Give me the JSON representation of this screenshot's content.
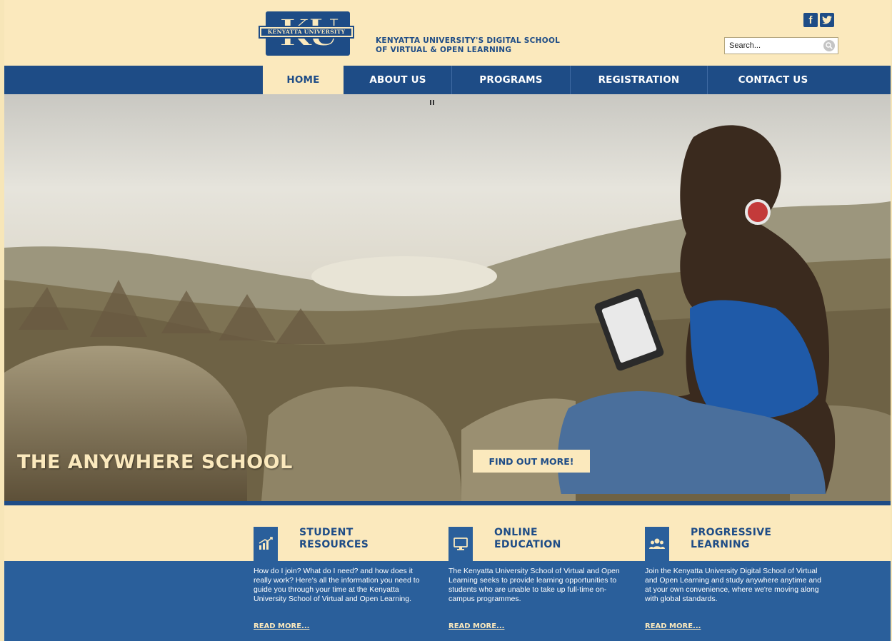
{
  "header": {
    "logo_initials": "KU",
    "logo_banner": "KENYATTA UNIVERSITY",
    "tagline_line1": "KENYATTA UNIVERSITY'S DIGITAL SCHOOL",
    "tagline_line2": "OF VIRTUAL & OPEN LEARNING",
    "social": {
      "facebook": "f",
      "twitter": "t"
    },
    "search_placeholder": "Search..."
  },
  "nav": {
    "items": [
      {
        "label": "HOME",
        "active": true
      },
      {
        "label": "ABOUT US",
        "active": false
      },
      {
        "label": "PROGRAMS",
        "active": false
      },
      {
        "label": "REGISTRATION",
        "active": false
      },
      {
        "label": "CONTACT US",
        "active": false
      }
    ]
  },
  "hero": {
    "title": "THE ANYWHERE SCHOOL",
    "button": "FIND OUT MORE!"
  },
  "features": [
    {
      "icon": "chart-up-icon",
      "title_line1": "STUDENT",
      "title_line2": "RESOURCES",
      "description": "How do I join? What do I need? and how does it really work? Here's all the information you need to guide you through your time at the Kenyatta University School of Virtual and Open Learning.",
      "read_more": "READ MORE..."
    },
    {
      "icon": "monitor-icon",
      "title_line1": "ONLINE",
      "title_line2": "EDUCATION",
      "description": "The Kenyatta University School of Virtual and Open Learning seeks to provide learning opportunities to students who are unable to take up full-time on-campus programmes.",
      "read_more": "READ MORE..."
    },
    {
      "icon": "people-icon",
      "title_line1": "PROGRESSIVE",
      "title_line2": "LEARNING",
      "description": "Join the Kenyatta University Digital School of Virtual and Open Learning and study anywhere anytime and at your own convenience, where we're moving along with global standards.",
      "read_more": "READ MORE..."
    }
  ],
  "colors": {
    "navy": "#1e4c86",
    "cream": "#fbe9bd",
    "panel_blue": "#2a5f9b"
  }
}
